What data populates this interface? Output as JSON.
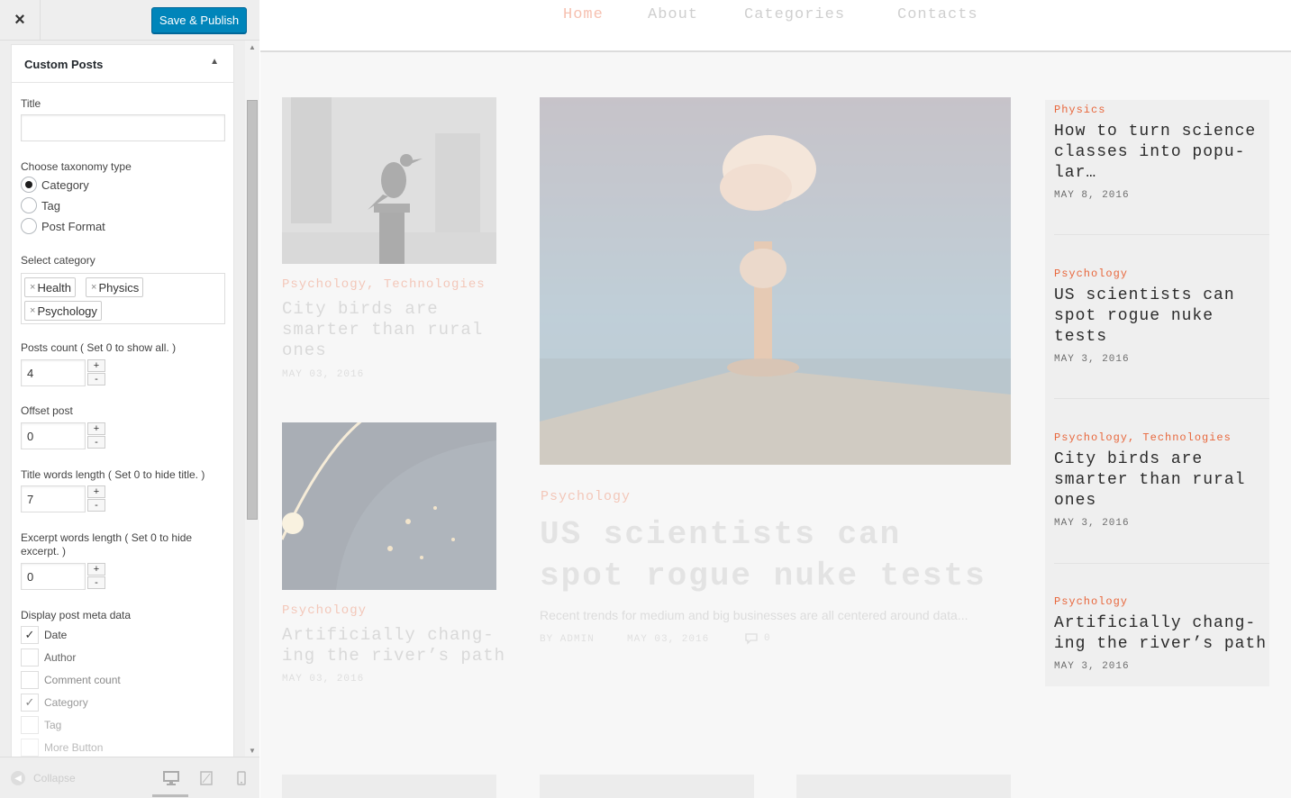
{
  "customizer": {
    "close_icon": "×",
    "publish_label": "Save & Publish",
    "widget_title": "Custom Posts",
    "fields": {
      "title_label": "Title",
      "title_value": "",
      "taxonomy_label": "Choose taxonomy type",
      "taxonomy_options": [
        "Category",
        "Tag",
        "Post Format"
      ],
      "taxonomy_selected": "Category",
      "select_category_label": "Select category",
      "categories_selected": [
        "Health",
        "Physics",
        "Psychology"
      ],
      "posts_count_label": "Posts count ( Set 0 to show all. )",
      "posts_count_value": "4",
      "offset_label": "Offset post",
      "offset_value": "0",
      "title_words_label": "Title words length ( Set 0 to hide title. )",
      "title_words_value": "7",
      "excerpt_words_label": "Excerpt words length ( Set 0 to hide excerpt. )",
      "excerpt_words_value": "0",
      "meta_label": "Display post meta data",
      "meta_options": [
        {
          "label": "Date",
          "checked": true
        },
        {
          "label": "Author",
          "checked": false
        },
        {
          "label": "Comment count",
          "checked": false
        },
        {
          "label": "Category",
          "checked": true
        },
        {
          "label": "Tag",
          "checked": false
        },
        {
          "label": "More Button",
          "checked": false
        }
      ],
      "stepper_plus": "+",
      "stepper_minus": "-"
    },
    "footer": {
      "collapse_label": "Collapse",
      "devices": [
        "desktop-icon",
        "tablet-icon",
        "mobile-icon"
      ]
    }
  },
  "preview": {
    "nav": [
      "Home",
      "About",
      "Categories",
      "Contacts"
    ],
    "nav_active": "Home",
    "left_posts": [
      {
        "categories": "Psychology, Technologies",
        "title_lines": [
          "City birds are",
          "smarter than rural",
          "ones"
        ],
        "date": "MAY 03, 2016"
      },
      {
        "categories": "Psychology",
        "title_lines": [
          "Artificially chang-",
          "ing the river’s path"
        ],
        "date": "MAY 03, 2016"
      }
    ],
    "featured": {
      "category": "Psychology",
      "title_lines": [
        "US scientists can",
        "spot rogue nuke tests"
      ],
      "excerpt": "Recent trends for medium and big businesses are all centered around data...",
      "author": "BY ADMIN",
      "date": "MAY 03, 2016",
      "comments": "0"
    },
    "sidebar_posts": [
      {
        "categories": "Physics",
        "title_lines": [
          "How to turn science",
          "classes into popu-",
          "lar…"
        ],
        "date": "MAY 8, 2016"
      },
      {
        "categories": "Psychology",
        "title_lines": [
          "US scientists can",
          "spot rogue nuke",
          "tests"
        ],
        "date": "MAY 3, 2016"
      },
      {
        "categories": "Psychology, Technologies",
        "title_lines": [
          "City birds are",
          "smarter than rural",
          "ones"
        ],
        "date": "MAY 3, 2016"
      },
      {
        "categories": "Psychology",
        "title_lines": [
          "Artificially chang-",
          "ing the river’s path"
        ],
        "date": "MAY 3, 2016"
      }
    ],
    "colors": {
      "accent": "#e8673c",
      "publish": "#0085ba"
    }
  }
}
